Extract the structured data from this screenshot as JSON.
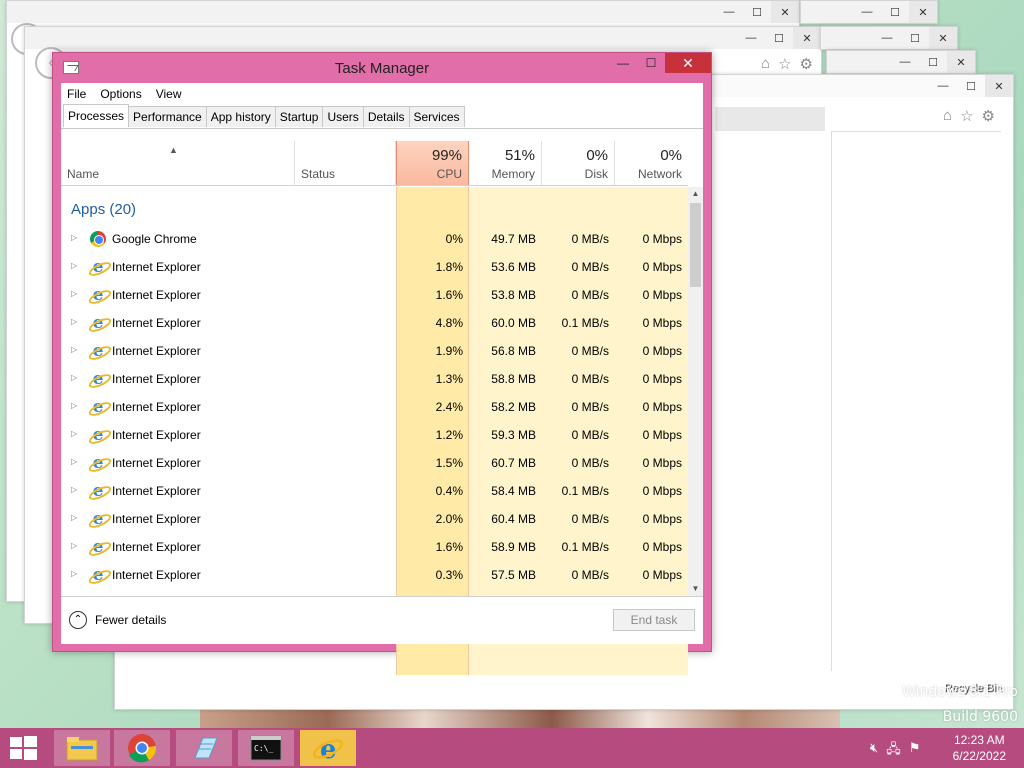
{
  "desktop": {
    "watermark_line1": "Windows 8.1 Pro",
    "watermark_line2": "Build 9600",
    "recycle_bin": "Recycle Bin"
  },
  "task_manager": {
    "title": "Task Manager",
    "menu": [
      "File",
      "Options",
      "View"
    ],
    "tabs": [
      "Processes",
      "Performance",
      "App history",
      "Startup",
      "Users",
      "Details",
      "Services"
    ],
    "active_tab": "Processes",
    "columns": {
      "name": "Name",
      "status": "Status",
      "cpu": {
        "pct": "99%",
        "label": "CPU"
      },
      "memory": {
        "pct": "51%",
        "label": "Memory"
      },
      "disk": {
        "pct": "0%",
        "label": "Disk"
      },
      "network": {
        "pct": "0%",
        "label": "Network"
      }
    },
    "group_label": "Apps (20)",
    "processes": [
      {
        "name": "Google Chrome",
        "icon": "chrome-icon",
        "cpu": "0%",
        "memory": "49.7 MB",
        "disk": "0 MB/s",
        "network": "0 Mbps"
      },
      {
        "name": "Internet Explorer",
        "icon": "ie-icon",
        "cpu": "1.8%",
        "memory": "53.6 MB",
        "disk": "0 MB/s",
        "network": "0 Mbps"
      },
      {
        "name": "Internet Explorer",
        "icon": "ie-icon",
        "cpu": "1.6%",
        "memory": "53.8 MB",
        "disk": "0 MB/s",
        "network": "0 Mbps"
      },
      {
        "name": "Internet Explorer",
        "icon": "ie-icon",
        "cpu": "4.8%",
        "memory": "60.0 MB",
        "disk": "0.1 MB/s",
        "network": "0 Mbps"
      },
      {
        "name": "Internet Explorer",
        "icon": "ie-icon",
        "cpu": "1.9%",
        "memory": "56.8 MB",
        "disk": "0 MB/s",
        "network": "0 Mbps"
      },
      {
        "name": "Internet Explorer",
        "icon": "ie-icon",
        "cpu": "1.3%",
        "memory": "58.8 MB",
        "disk": "0 MB/s",
        "network": "0 Mbps"
      },
      {
        "name": "Internet Explorer",
        "icon": "ie-icon",
        "cpu": "2.4%",
        "memory": "58.2 MB",
        "disk": "0 MB/s",
        "network": "0 Mbps"
      },
      {
        "name": "Internet Explorer",
        "icon": "ie-icon",
        "cpu": "1.2%",
        "memory": "59.3 MB",
        "disk": "0 MB/s",
        "network": "0 Mbps"
      },
      {
        "name": "Internet Explorer",
        "icon": "ie-icon",
        "cpu": "1.5%",
        "memory": "60.7 MB",
        "disk": "0 MB/s",
        "network": "0 Mbps"
      },
      {
        "name": "Internet Explorer",
        "icon": "ie-icon",
        "cpu": "0.4%",
        "memory": "58.4 MB",
        "disk": "0.1 MB/s",
        "network": "0 Mbps"
      },
      {
        "name": "Internet Explorer",
        "icon": "ie-icon",
        "cpu": "2.0%",
        "memory": "60.4 MB",
        "disk": "0 MB/s",
        "network": "0 Mbps"
      },
      {
        "name": "Internet Explorer",
        "icon": "ie-icon",
        "cpu": "1.6%",
        "memory": "58.9 MB",
        "disk": "0.1 MB/s",
        "network": "0 Mbps"
      },
      {
        "name": "Internet Explorer",
        "icon": "ie-icon",
        "cpu": "0.3%",
        "memory": "57.5 MB",
        "disk": "0 MB/s",
        "network": "0 Mbps"
      }
    ],
    "fewer_details": "Fewer details",
    "end_task": "End task"
  },
  "taskbar": {
    "apps": [
      "file-explorer-icon",
      "chrome-icon",
      "notepad-icon",
      "command-prompt-icon",
      "internet-explorer-icon"
    ],
    "clock_time": "12:23 AM",
    "clock_date": "6/22/2022"
  },
  "colors": {
    "taskbar": "#b64b7f",
    "window_frame": "#e26ea9",
    "cpu_header": "#f9b9a0",
    "heat_light": "#fff4cc",
    "heat_mid": "#ffe9a8",
    "group_text": "#1e5fa8"
  }
}
